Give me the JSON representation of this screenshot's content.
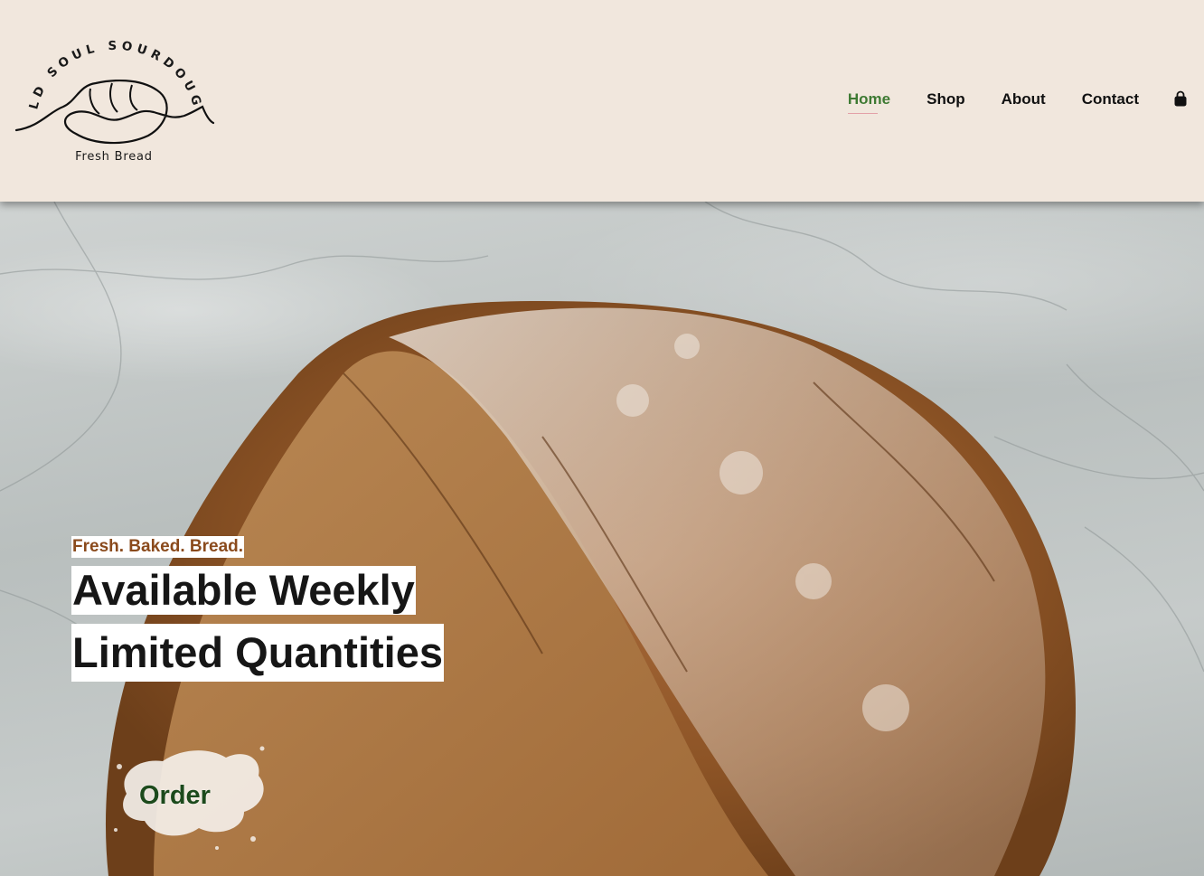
{
  "brand": {
    "arc_text": "OLD SOUL SOURDOUGH",
    "subtitle": "Fresh Bread"
  },
  "nav": {
    "items": [
      {
        "label": "Home",
        "active": true
      },
      {
        "label": "Shop",
        "active": false
      },
      {
        "label": "About",
        "active": false
      },
      {
        "label": "Contact",
        "active": false
      }
    ],
    "cart_icon": "shopping-bag-icon"
  },
  "hero": {
    "tagline": "Fresh. Baked. Bread.",
    "headline_1": "Available Weekly",
    "headline_2": "Limited Quantities",
    "cta_label": "Order"
  },
  "colors": {
    "header_bg": "#f1e7dd",
    "nav_active": "#3e7a33",
    "tagline": "#8a4a1c",
    "cta": "#1c4a1c"
  }
}
